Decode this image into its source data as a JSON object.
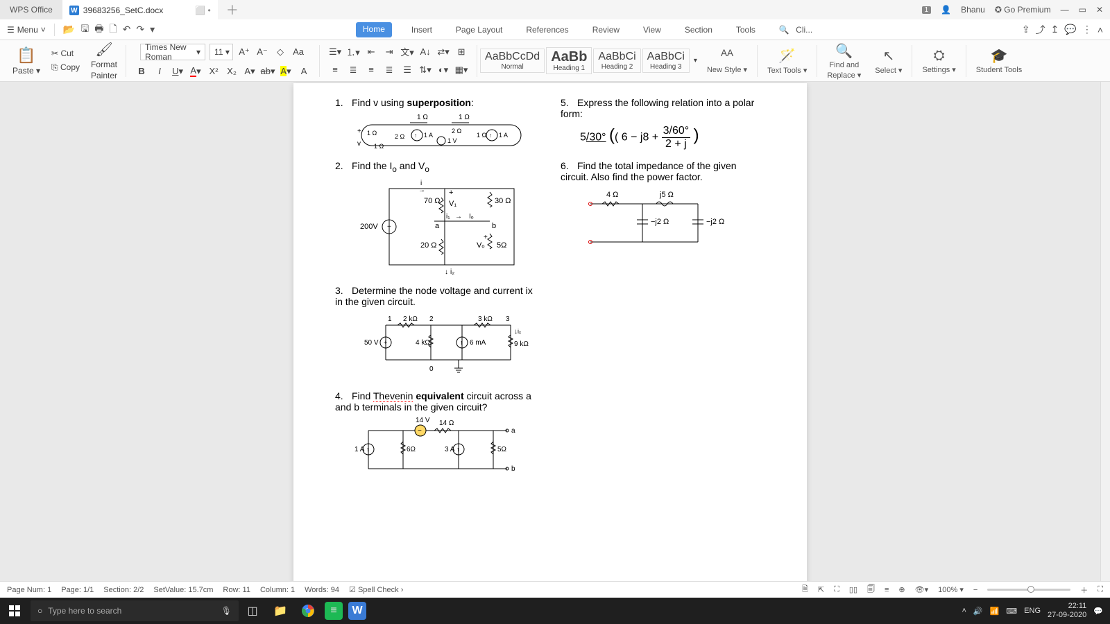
{
  "title": {
    "app": "WPS Office",
    "doc": "39683256_SetC.docx",
    "user": "Bhanu",
    "premium": "Go Premium",
    "badge": "1"
  },
  "menu": {
    "label": "Menu"
  },
  "nav": {
    "home": "Home",
    "insert": "Insert",
    "layout": "Page Layout",
    "refs": "References",
    "review": "Review",
    "view": "View",
    "section": "Section",
    "tools": "Tools",
    "search": "Cli..."
  },
  "clipboard": {
    "paste": "Paste",
    "cut": "Cut",
    "copy": "Copy",
    "format": "Format",
    "painter": "Painter"
  },
  "font": {
    "name": "Times New Roman",
    "size": "11"
  },
  "styles": {
    "normal_preview": "AaBbCcDd",
    "normal": "Normal",
    "h1_preview": "AaBb",
    "h1": "Heading 1",
    "h2_preview": "AaBbCi",
    "h2": "Heading 2",
    "h3_preview": "AaBbCi",
    "h3": "Heading 3",
    "new": "New Style"
  },
  "tools": {
    "texttools": "Text Tools",
    "find": "Find and",
    "replace": "Replace",
    "select": "Select",
    "settings": "Settings",
    "student": "Student Tools"
  },
  "doc": {
    "q1": "Find v using ",
    "q1b": "superposition",
    "q2": "Find the I",
    "q2sub": "o",
    "q2mid": " and V",
    "q2sub2": "o",
    "q3": "Determine the node voltage and current ix in the given circuit.",
    "q4a": "Find ",
    "q4b": "Thevenin",
    "q4c": " equivalent",
    " q4d": " circuit across a and b terminals in the given circuit?",
    "q5": "Express the following relation into a polar form:",
    "q5eq_a": "5",
    "q5eq_ang": "/30°",
    "q5eq_par": "( 6 − j8 + ",
    "q5eq_frac_top": "3/60°",
    "q5eq_frac_bot": "2 + j",
    "q5eq_close": ")",
    "q6": "Find the total impedance of the given circuit. Also find the power factor.",
    "d2": {
      "v200": "200V",
      "r70": "70 Ω",
      "r30": "30 Ω",
      "r20": "20 Ω",
      "r5": "5Ω",
      "v1": "V₁",
      "vo": "Vₒ",
      "i1": "i₁",
      "io": "Iₒ",
      "i2": "i₂",
      "a": "a",
      "b": "b",
      "plus": "+"
    },
    "d3": {
      "v50": "50 V",
      "k2": "2 kΩ",
      "k4": "4 kΩ",
      "k3": "3 kΩ",
      "k9": "9 kΩ",
      "ma6": "6 mA",
      "n1": "1",
      "n2": "2",
      "n3": "3",
      "n0": "0",
      "ix": "iₓ"
    },
    "d4": {
      "i1a": "1 A",
      "i3a": "3 A",
      "v14": "14 V",
      "r14": "14 Ω",
      "r6": "6Ω",
      "r5": "5Ω",
      "a": "a",
      "b": "b"
    },
    "d6": {
      "r4": "4 Ω",
      "j5": "j5 Ω",
      "nj2a": "−j2 Ω",
      "nj2b": "−j2 Ω"
    }
  },
  "status": {
    "pagenum": "Page Num: 1",
    "page": "Page: 1/1",
    "section": "Section: 2/2",
    "setval": "SetValue: 15.7cm",
    "row": "Row: 11",
    "col": "Column: 1",
    "words": "Words: 94",
    "spell": "Spell Check",
    "zoom": "100%"
  },
  "taskbar": {
    "search": "Type here to search",
    "lang": "ENG",
    "time": "22:11",
    "date": "27-09-2020"
  }
}
